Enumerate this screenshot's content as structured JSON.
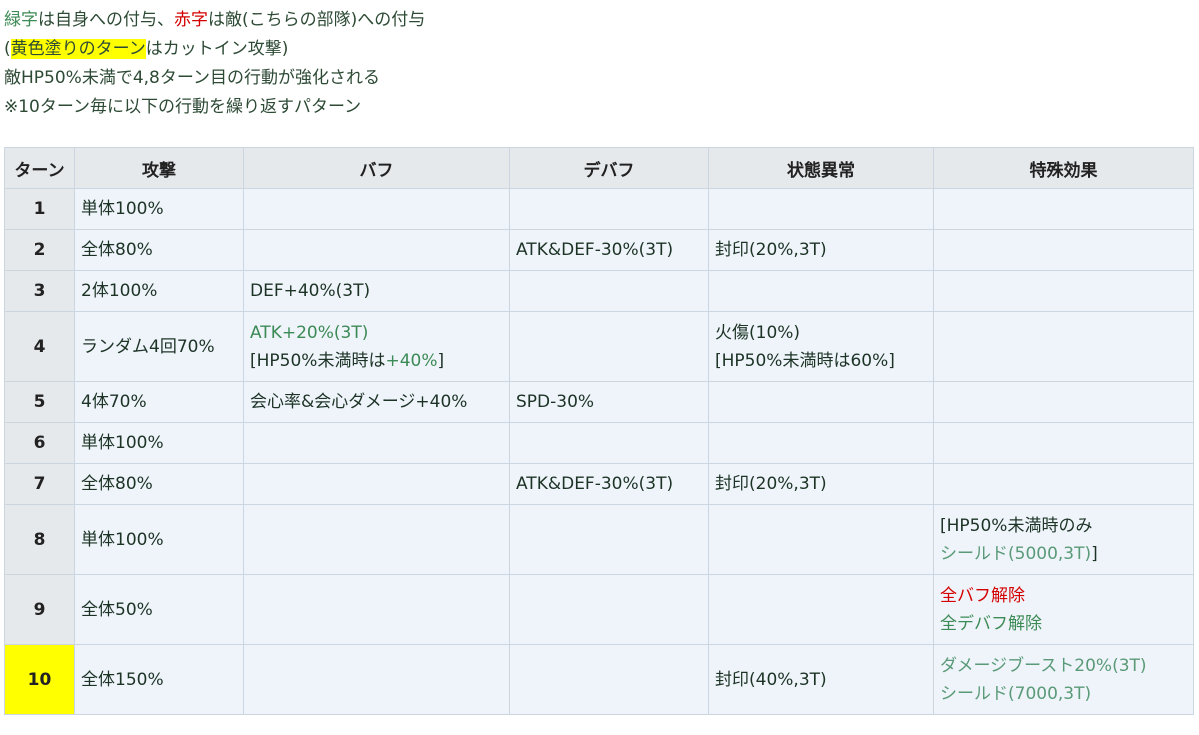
{
  "notes": {
    "line1": {
      "green_word": "緑字",
      "part_a": "は自身への付与、",
      "red_word": "赤字",
      "part_b": "は敵(こちらの部隊)への付与"
    },
    "line2": {
      "open": "(",
      "highlight": "黄色塗りのターン",
      "rest": "はカットイン攻撃)"
    },
    "line3": "敵HP50%未満で4,8ターン目の行動が強化される",
    "line4": "※10ターン毎に以下の行動を繰り返すパターン"
  },
  "table": {
    "headers": [
      "ターン",
      "攻撃",
      "バフ",
      "デバフ",
      "状態異常",
      "特殊効果"
    ],
    "rows": [
      {
        "turn": "1",
        "attack": "単体100%",
        "buff": "",
        "debuff": "",
        "status": "",
        "special": ""
      },
      {
        "turn": "2",
        "attack": "全体80%",
        "buff": "",
        "debuff": "ATK&DEF-30%(3T)",
        "status": "封印(20%,3T)",
        "special": ""
      },
      {
        "turn": "3",
        "attack": "2体100%",
        "buff": "DEF+40%(3T)",
        "debuff": "",
        "status": "",
        "special": ""
      },
      {
        "turn": "4",
        "attack": "ランダム4回70%",
        "buff_1": "ATK+20%(3T)",
        "buff_2a": "[HP50%未満時は",
        "buff_2b": "+40%",
        "buff_2c": "]",
        "debuff": "",
        "status_1": "火傷(10%)",
        "status_2": "[HP50%未満時は60%]",
        "special": ""
      },
      {
        "turn": "5",
        "attack": "4体70%",
        "buff": "会心率&会心ダメージ+40%",
        "debuff": "SPD-30%",
        "status": "",
        "special": ""
      },
      {
        "turn": "6",
        "attack": "単体100%",
        "buff": "",
        "debuff": "",
        "status": "",
        "special": ""
      },
      {
        "turn": "7",
        "attack": "全体80%",
        "buff": "",
        "debuff": "ATK&DEF-30%(3T)",
        "status": "封印(20%,3T)",
        "special": ""
      },
      {
        "turn": "8",
        "attack": "単体100%",
        "buff": "",
        "debuff": "",
        "status": "",
        "special_1": "[HP50%未満時のみ",
        "special_2a": "シールド(5000,3T)",
        "special_2b": "]"
      },
      {
        "turn": "9",
        "attack": "全体50%",
        "buff": "",
        "debuff": "",
        "status": "",
        "special_1": "全バフ解除",
        "special_2": "全デバフ解除"
      },
      {
        "turn": "10",
        "attack": "全体150%",
        "buff": "",
        "debuff": "",
        "status": "封印(40%,3T)",
        "special_1": "ダメージブースト20%(3T)",
        "special_2": "シールド(7000,3T)"
      }
    ]
  },
  "colors": {
    "self_buff": "#3c8a55",
    "enemy_debuff": "#d40000",
    "cutin_highlight": "#ffff00",
    "header_bg": "#e6e9ec",
    "cell_bg": "#eef4fa"
  }
}
